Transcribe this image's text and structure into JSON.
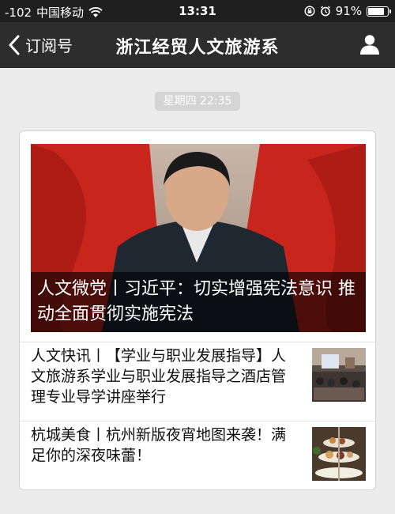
{
  "status_bar": {
    "signal": "-102",
    "carrier": "中国移动",
    "time": "13:31",
    "battery": "91%",
    "battery_level": 0.91,
    "icons": [
      "wifi-icon",
      "rotation-lock-icon",
      "alarm-icon",
      "battery-icon"
    ]
  },
  "nav": {
    "back_label": "订阅号",
    "title": "浙江经贸人文旅游系",
    "back_icon": "chevron-left-icon",
    "profile_icon": "person-icon"
  },
  "message": {
    "timestamp": "星期四 22:35",
    "hero": {
      "title": "人文微党丨习近平：切实增强宪法意识 推动全面贯彻实施宪法"
    },
    "items": [
      {
        "title": "人文快讯丨【学业与职业发展指导】人文旅游系学业与职业发展指导之酒店管理专业导学讲座举行"
      },
      {
        "title": "杭城美食丨杭州新版夜宵地图来袭！满足你的深夜味蕾！"
      }
    ]
  },
  "colors": {
    "status_bar_bg": "#1f1f1f",
    "nav_bg": "#2d2d2d",
    "page_bg": "#ececec",
    "hero_flag_red": "#c8261c"
  }
}
